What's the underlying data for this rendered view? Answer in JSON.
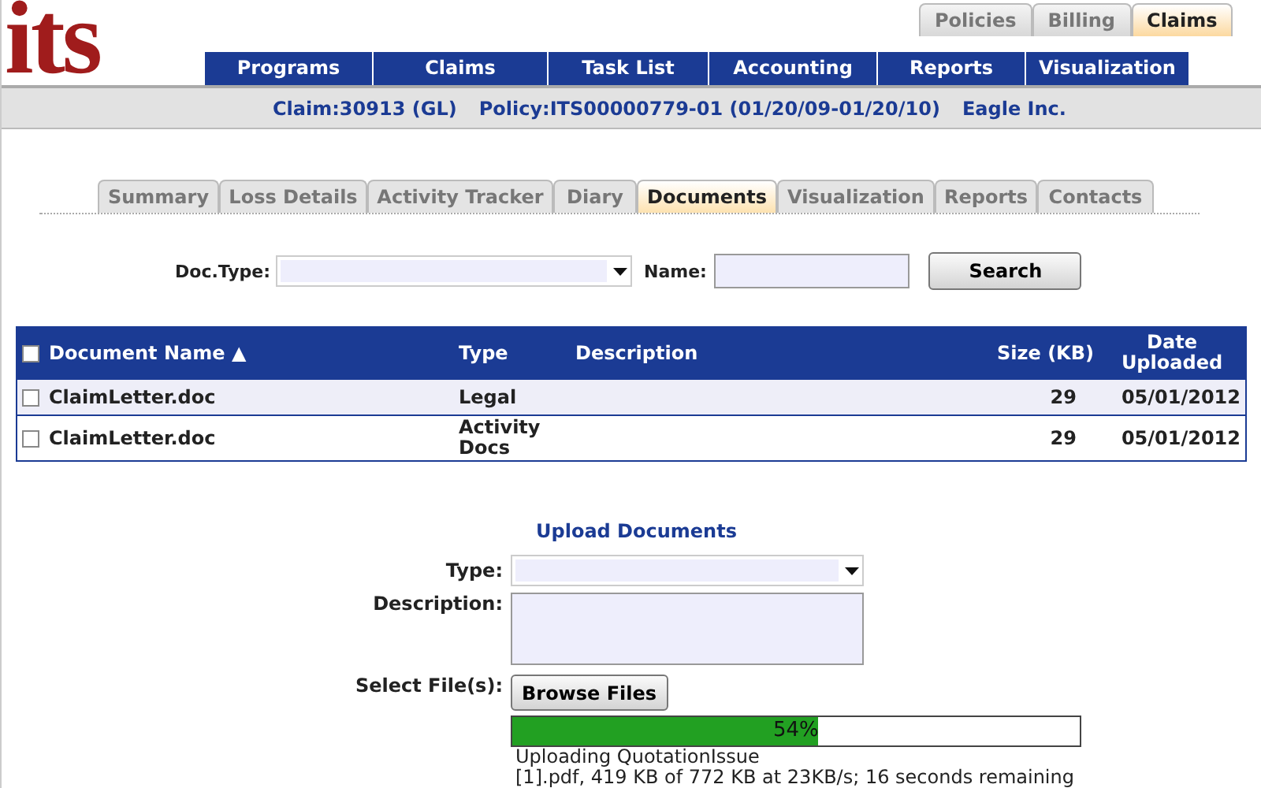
{
  "logo": "its",
  "top_tabs": [
    {
      "label": "Policies",
      "selected": false
    },
    {
      "label": "Billing",
      "selected": false
    },
    {
      "label": "Claims",
      "selected": true
    }
  ],
  "nav": [
    "Programs",
    "Claims",
    "Task List",
    "Accounting",
    "Reports",
    "Visualization"
  ],
  "claim_bar": {
    "claim": "Claim:30913 (GL)",
    "policy": "Policy:ITS00000779-01 (01/20/09-01/20/10)",
    "insured": "Eagle Inc."
  },
  "sub_tabs": [
    {
      "label": "Summary",
      "selected": false
    },
    {
      "label": "Loss Details",
      "selected": false
    },
    {
      "label": "Activity Tracker",
      "selected": false
    },
    {
      "label": "Diary",
      "selected": false
    },
    {
      "label": "Documents",
      "selected": true
    },
    {
      "label": "Visualization",
      "selected": false
    },
    {
      "label": "Reports",
      "selected": false
    },
    {
      "label": "Contacts",
      "selected": false
    }
  ],
  "search": {
    "doc_type_label": "Doc.Type:",
    "name_label": "Name:",
    "button": "Search"
  },
  "table": {
    "select_all": {
      "checked": false
    },
    "sort_indicator": "▲",
    "columns": [
      "Document Name",
      "Type",
      "Description",
      "Size (KB)",
      "Date Uploaded"
    ],
    "rows": [
      {
        "checked": false,
        "name": "ClaimLetter.doc",
        "type": "Legal",
        "size": "29",
        "date": "05/01/2012"
      },
      {
        "checked": false,
        "name": "ClaimLetter.doc",
        "type": "Activity Docs",
        "size": "29",
        "date": "05/01/2012"
      }
    ]
  },
  "upload": {
    "title": "Upload Documents",
    "type_label": "Type:",
    "description_label": "Description:",
    "select_label": "Select File(s):",
    "browse_button": "Browse Files",
    "progress": {
      "level": 0.54,
      "reading": "54%"
    },
    "status_lines": [
      "Uploading QuotationIssue",
      "[1].pdf, 419 KB of 772 KB at 23KB/s; 16 seconds remaining"
    ]
  }
}
